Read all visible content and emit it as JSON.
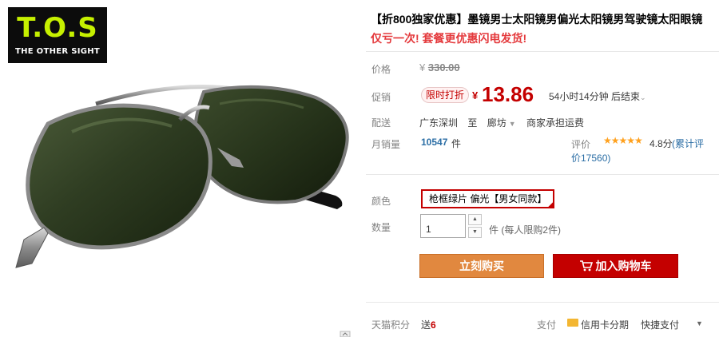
{
  "brand": {
    "logo_main": "T.O.S",
    "logo_sub": "THE OTHER SIGHT"
  },
  "product": {
    "title": "【折800独家优惠】墨镜男士太阳镜男偏光太阳镜男驾驶镜太阳眼镜",
    "subtitle": "仅亏一次! 套餐更优惠闪电发货!"
  },
  "price": {
    "label": "价格",
    "currency": "¥",
    "original": "330.00",
    "promo_label": "促销",
    "promo_tag": "限时打折",
    "current": "13.86",
    "countdown": "54小时14分钟 后结束"
  },
  "shipping": {
    "label": "配送",
    "from": "广东深圳",
    "to_word": "至",
    "to": "廊坊",
    "method": "商家承担运费"
  },
  "sales": {
    "label": "月销量",
    "count": "10547",
    "unit": "件",
    "review_label": "评价",
    "stars": "★★★★★",
    "rating": "4.8分",
    "review_link_a": "(累计评",
    "review_link_b": "价17560)"
  },
  "color": {
    "label": "颜色",
    "selected": "枪框绿片 偏光【男女同款】"
  },
  "quantity": {
    "label": "数量",
    "value": "1",
    "up": "▲",
    "down": "▼",
    "note": "件 (每人限购2件)"
  },
  "actions": {
    "buy_now": "立刻购买",
    "add_to_cart": "加入购物车"
  },
  "footer": {
    "points_label": "天猫积分",
    "gift_word": "送",
    "gift_value": "6",
    "pay_label": "支付",
    "credit_card": "信用卡分期",
    "quick_pay": "快捷支付"
  },
  "colors": {
    "accent_red": "#c40000",
    "buy_orange": "#e1883f",
    "link_blue": "#2b6ea5",
    "logo_green": "#c6f000"
  }
}
